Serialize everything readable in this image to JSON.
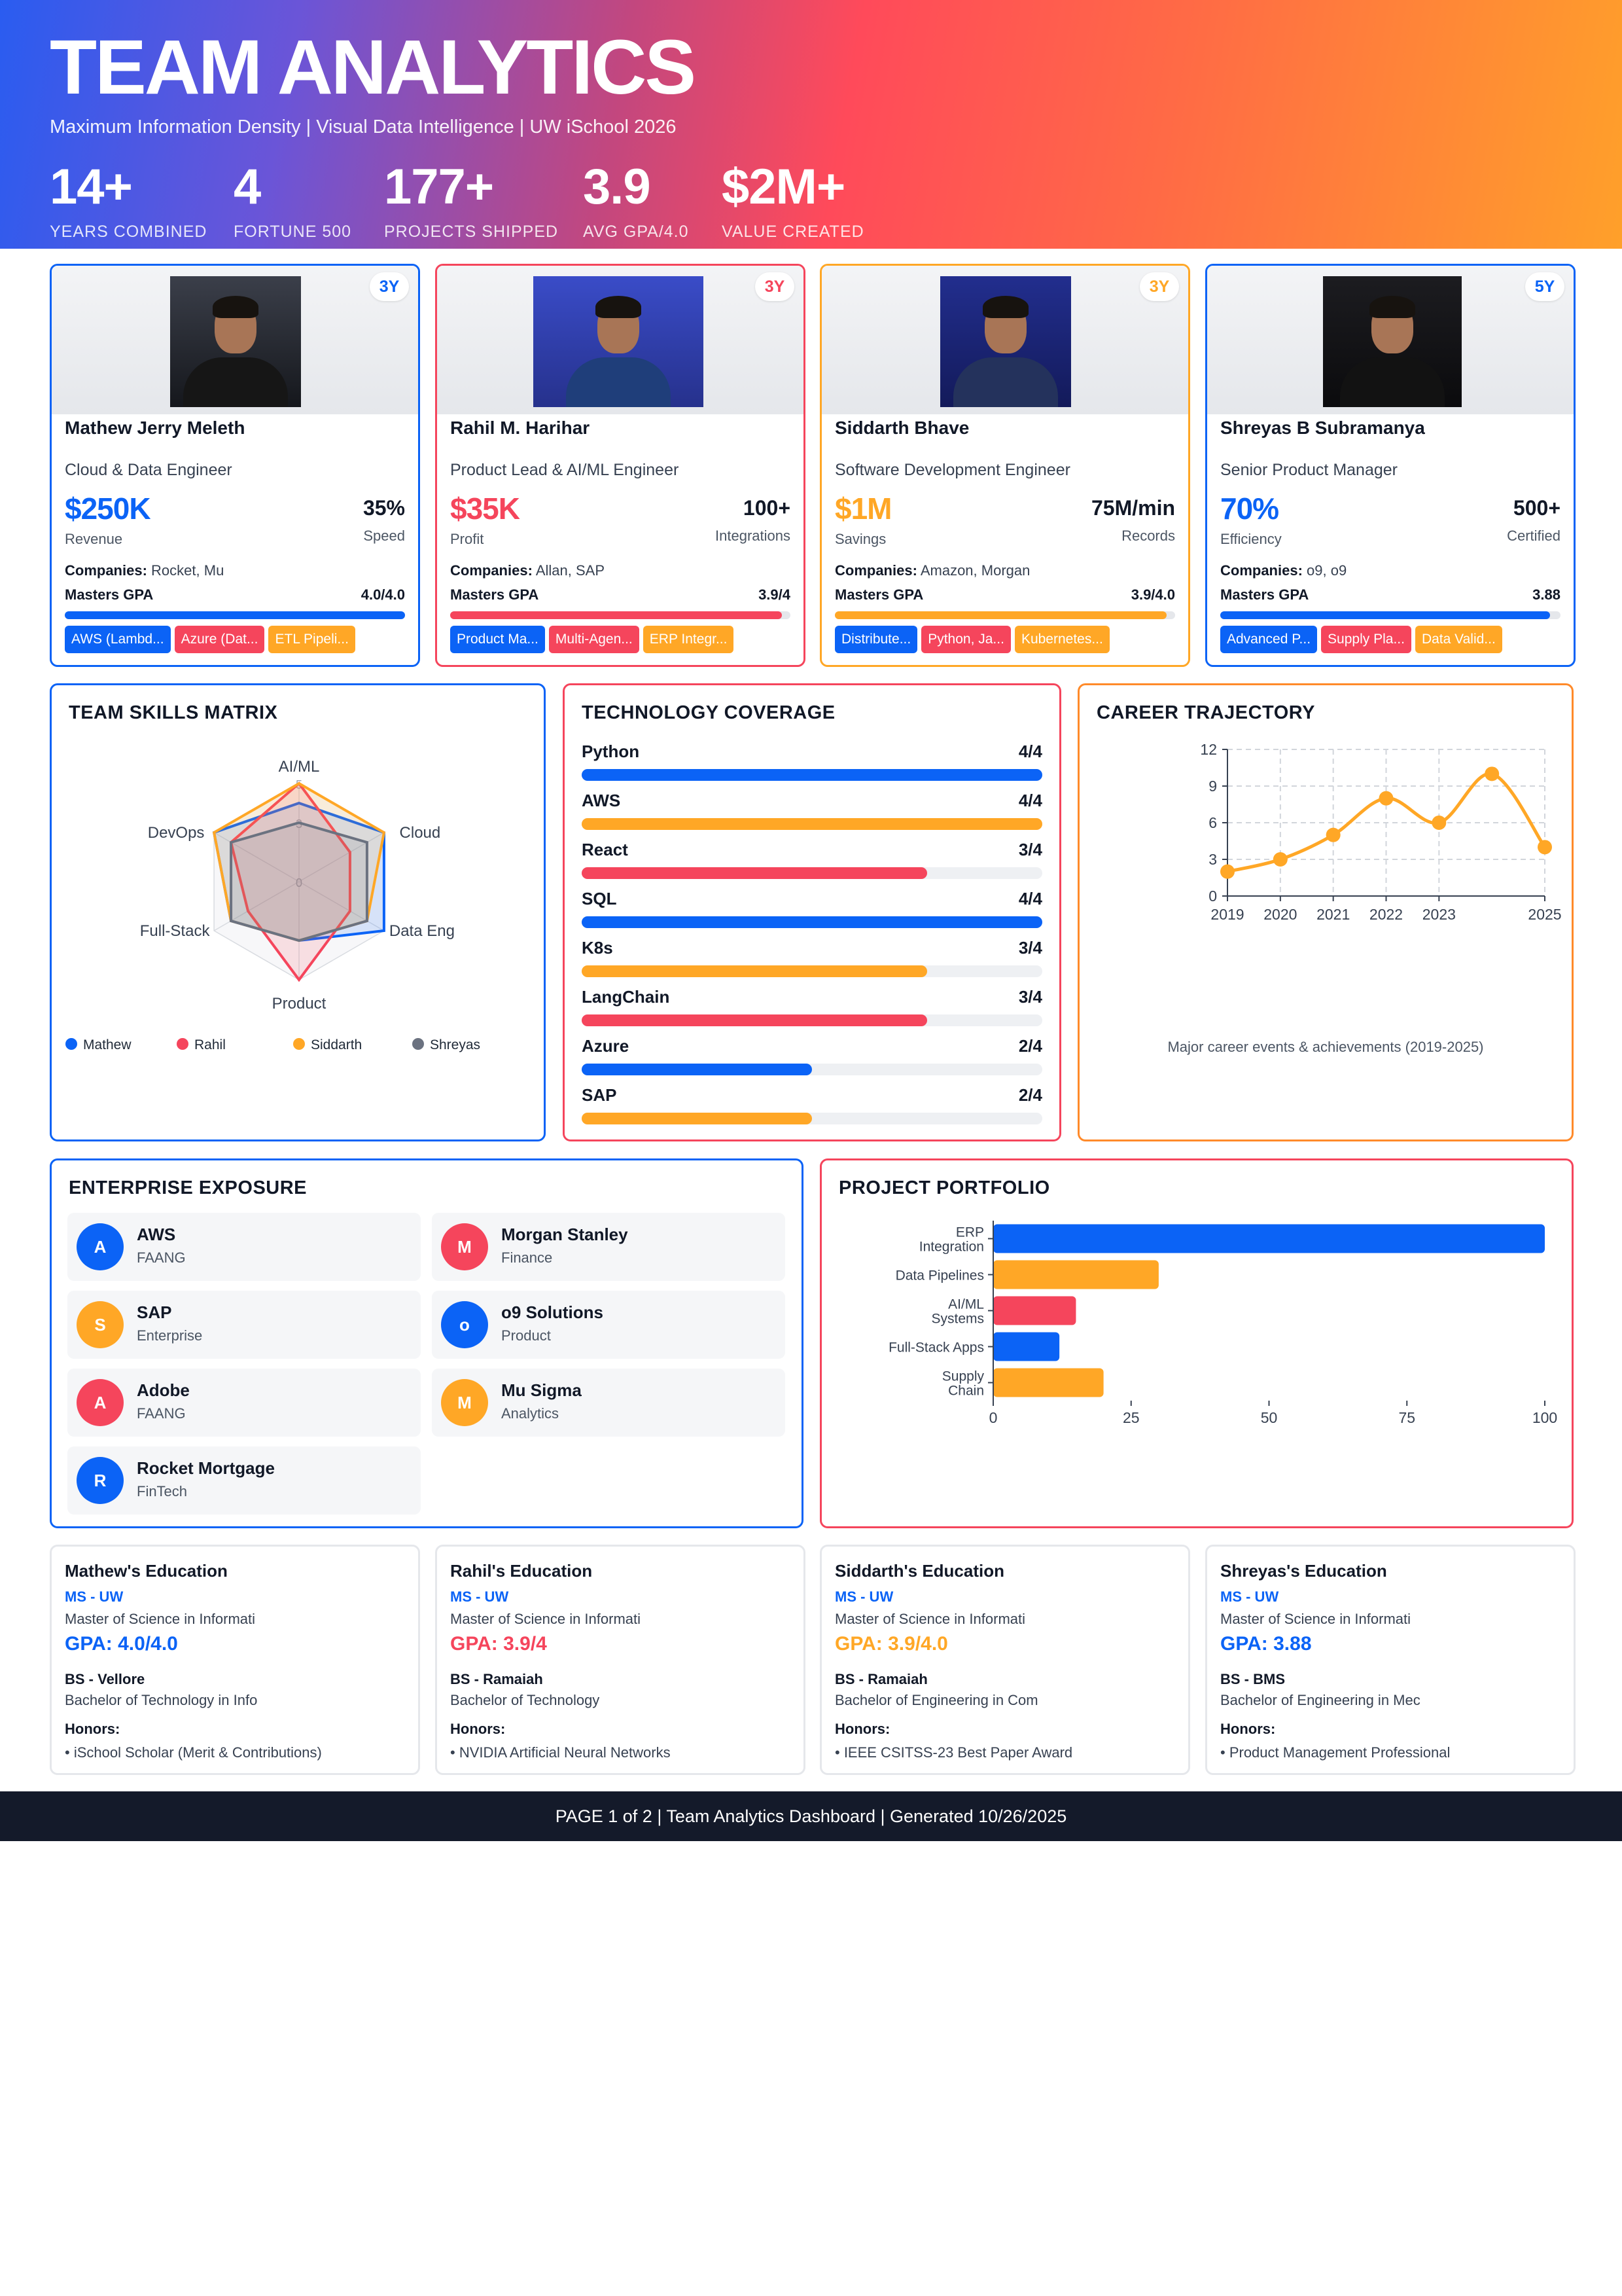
{
  "header": {
    "title": "TEAM ANALYTICS",
    "subtitle": "Maximum Information Density | Visual Data Intelligence | UW iSchool 2026",
    "stats": [
      {
        "value": "14+",
        "label": "YEARS COMBINED"
      },
      {
        "value": "4",
        "label": "FORTUNE 500"
      },
      {
        "value": "177+",
        "label": "PROJECTS SHIPPED"
      },
      {
        "value": "3.9",
        "label": "AVG GPA/4.0"
      },
      {
        "value": "$2M+",
        "label": "VALUE CREATED"
      }
    ]
  },
  "colors": {
    "blue": "#0b63f6",
    "red": "#f5455c",
    "orange": "#ffa726",
    "gray": "#6b7280"
  },
  "profiles": [
    {
      "name": "Mathew Jerry Meleth",
      "badge": "3Y",
      "role": "Cloud & Data Engineer",
      "metric_value": "$250K",
      "metric_label": "Revenue",
      "secondary_value": "35%",
      "secondary_label": "Speed",
      "companies_label": "Companies:",
      "companies": "Rocket, Mu",
      "gpa_label": "Masters GPA",
      "gpa": "4.0/4.0",
      "gpa_fraction": 1.0,
      "tags": [
        "AWS (Lambd...",
        "Azure (Dat...",
        "ETL Pipeli..."
      ]
    },
    {
      "name": "Rahil M. Harihar",
      "badge": "3Y",
      "role": "Product Lead & AI/ML Engineer",
      "metric_value": "$35K",
      "metric_label": "Profit",
      "secondary_value": "100+",
      "secondary_label": "Integrations",
      "companies_label": "Companies:",
      "companies": "Allan, SAP",
      "gpa_label": "Masters GPA",
      "gpa": "3.9/4",
      "gpa_fraction": 0.975,
      "tags": [
        "Product Ma...",
        "Multi-Agen...",
        "ERP Integr..."
      ]
    },
    {
      "name": "Siddarth Bhave",
      "badge": "3Y",
      "role": "Software Development Engineer",
      "metric_value": "$1M",
      "metric_label": "Savings",
      "secondary_value": "75M/min",
      "secondary_label": "Records",
      "companies_label": "Companies:",
      "companies": "Amazon, Morgan",
      "gpa_label": "Masters GPA",
      "gpa": "3.9/4.0",
      "gpa_fraction": 0.975,
      "tags": [
        "Distribute...",
        "Python, Ja...",
        "Kubernetes..."
      ]
    },
    {
      "name": "Shreyas B Subramanya",
      "badge": "5Y",
      "role": "Senior Product Manager",
      "metric_value": "70%",
      "metric_label": "Efficiency",
      "secondary_value": "500+",
      "secondary_label": "Certified",
      "companies_label": "Companies:",
      "companies": "o9, o9",
      "gpa_label": "Masters GPA",
      "gpa": "3.88",
      "gpa_fraction": 0.97,
      "tags": [
        "Advanced P...",
        "Supply Pla...",
        "Data Valid..."
      ]
    }
  ],
  "skills_matrix": {
    "title": "TEAM SKILLS MATRIX",
    "axes": [
      "AI/ML",
      "Cloud",
      "Data Eng",
      "Product",
      "Full-Stack",
      "DevOps"
    ],
    "ticks": [
      "5",
      "3",
      "0"
    ],
    "series": [
      {
        "name": "Mathew",
        "values": [
          4,
          5,
          5,
          3,
          4,
          5
        ]
      },
      {
        "name": "Rahil",
        "values": [
          5,
          3,
          3,
          5,
          3,
          4
        ]
      },
      {
        "name": "Siddarth",
        "values": [
          5,
          5,
          4,
          3,
          4,
          5
        ]
      },
      {
        "name": "Shreyas",
        "values": [
          3,
          4,
          4,
          3,
          4,
          4
        ]
      }
    ]
  },
  "tech_coverage": {
    "title": "TECHNOLOGY COVERAGE",
    "items": [
      {
        "name": "Python",
        "label": "4/4",
        "value": 4,
        "max": 4
      },
      {
        "name": "AWS",
        "label": "4/4",
        "value": 4,
        "max": 4
      },
      {
        "name": "React",
        "label": "3/4",
        "value": 3,
        "max": 4
      },
      {
        "name": "SQL",
        "label": "4/4",
        "value": 4,
        "max": 4
      },
      {
        "name": "K8s",
        "label": "3/4",
        "value": 3,
        "max": 4
      },
      {
        "name": "LangChain",
        "label": "3/4",
        "value": 3,
        "max": 4
      },
      {
        "name": "Azure",
        "label": "2/4",
        "value": 2,
        "max": 4
      },
      {
        "name": "SAP",
        "label": "2/4",
        "value": 2,
        "max": 4
      }
    ]
  },
  "career": {
    "title": "CAREER TRAJECTORY",
    "caption": "Major career events & achievements (2019-2025)"
  },
  "enterprise": {
    "title": "ENTERPRISE EXPOSURE",
    "items": [
      {
        "initial": "A",
        "name": "AWS",
        "sub": "FAANG",
        "color": "#0b63f6"
      },
      {
        "initial": "M",
        "name": "Morgan Stanley",
        "sub": "Finance",
        "color": "#f5455c"
      },
      {
        "initial": "S",
        "name": "SAP",
        "sub": "Enterprise",
        "color": "#ffa726"
      },
      {
        "initial": "o",
        "name": "o9 Solutions",
        "sub": "Product",
        "color": "#0b63f6"
      },
      {
        "initial": "A",
        "name": "Adobe",
        "sub": "FAANG",
        "color": "#f5455c"
      },
      {
        "initial": "M",
        "name": "Mu Sigma",
        "sub": "Analytics",
        "color": "#ffa726"
      },
      {
        "initial": "R",
        "name": "Rocket Mortgage",
        "sub": "FinTech",
        "color": "#0b63f6"
      }
    ]
  },
  "portfolio": {
    "title": "PROJECT PORTFOLIO"
  },
  "chart_data": [
    {
      "type": "line",
      "title": "CAREER TRAJECTORY",
      "x": [
        2019,
        2020,
        2021,
        2022,
        2023,
        2024,
        2025
      ],
      "xticks": [
        2019,
        2020,
        2021,
        2022,
        2023,
        2025
      ],
      "values": [
        2,
        3,
        5,
        8,
        6,
        10,
        4
      ],
      "ylim": [
        0,
        12
      ],
      "yticks": [
        0,
        3,
        6,
        9,
        12
      ],
      "grid": true,
      "color": "#ffa726"
    },
    {
      "type": "bar",
      "orientation": "horizontal",
      "title": "PROJECT PORTFOLIO",
      "categories": [
        [
          "ERP",
          "Integration"
        ],
        [
          "Data Pipelines"
        ],
        [
          "AI/ML",
          "Systems"
        ],
        [
          "Full-Stack Apps"
        ],
        [
          "Supply",
          "Chain"
        ]
      ],
      "values": [
        100,
        30,
        15,
        12,
        20
      ],
      "colors": [
        "#0b63f6",
        "#ffa726",
        "#f5455c",
        "#0b63f6",
        "#ffa726"
      ],
      "xlim": [
        0,
        100
      ],
      "xticks": [
        0,
        25,
        50,
        75,
        100
      ]
    }
  ],
  "education": [
    {
      "title": "Mathew's Education",
      "ms": "MS - UW",
      "ms_desc": "Master of Science in Informati",
      "gpa": "GPA: 4.0/4.0",
      "bs": "BS - Vellore",
      "bs_desc": "Bachelor of Technology in Info",
      "honors_label": "Honors:",
      "honors": "• iSchool Scholar (Merit & Contributions)"
    },
    {
      "title": "Rahil's Education",
      "ms": "MS - UW",
      "ms_desc": "Master of Science in Informati",
      "gpa": "GPA: 3.9/4",
      "bs": "BS - Ramaiah",
      "bs_desc": "Bachelor of Technology",
      "honors_label": "Honors:",
      "honors": "• NVIDIA Artificial Neural Networks"
    },
    {
      "title": "Siddarth's Education",
      "ms": "MS - UW",
      "ms_desc": "Master of Science in Informati",
      "gpa": "GPA: 3.9/4.0",
      "bs": "BS - Ramaiah",
      "bs_desc": "Bachelor of Engineering in Com",
      "honors_label": "Honors:",
      "honors": "• IEEE CSITSS-23 Best Paper Award"
    },
    {
      "title": "Shreyas's Education",
      "ms": "MS - UW",
      "ms_desc": "Master of Science in Informati",
      "gpa": "GPA: 3.88",
      "bs": "BS - BMS",
      "bs_desc": "Bachelor of Engineering in Mec",
      "honors_label": "Honors:",
      "honors": "• Product Management Professional"
    }
  ],
  "footer": "PAGE 1 of 2 | Team Analytics Dashboard | Generated 10/26/2025"
}
